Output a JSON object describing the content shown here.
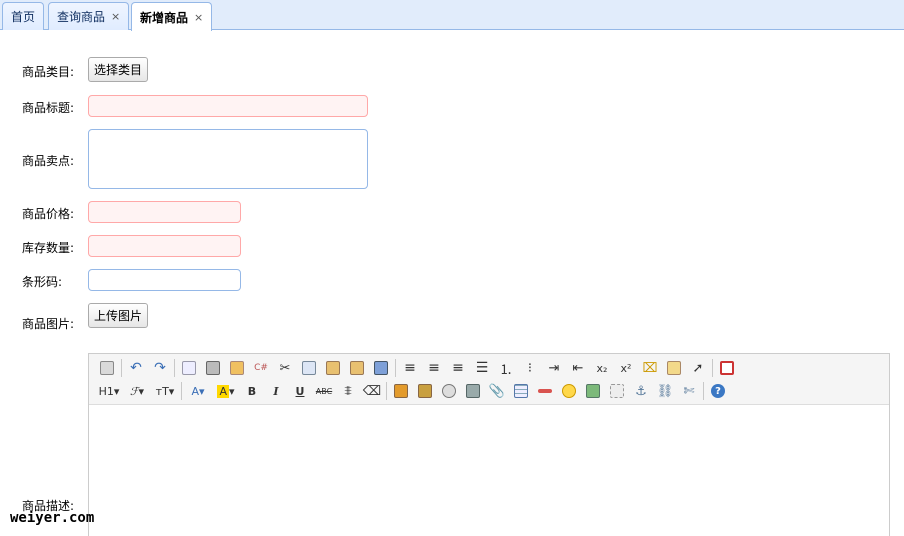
{
  "tabs": [
    {
      "label": "首页",
      "closable": false,
      "active": false
    },
    {
      "label": "查询商品",
      "closable": true,
      "active": false
    },
    {
      "label": "新增商品",
      "closable": true,
      "active": true
    }
  ],
  "close_glyph": "×",
  "form": {
    "category_label": "商品类目:",
    "category_button": "选择类目",
    "title_label": "商品标题:",
    "title_value": "",
    "sellpoint_label": "商品卖点:",
    "sellpoint_value": "",
    "price_label": "商品价格:",
    "price_value": "",
    "stock_label": "库存数量:",
    "stock_value": "",
    "barcode_label": "条形码:",
    "barcode_value": "",
    "image_label": "商品图片:",
    "image_button": "上传图片",
    "desc_label": "商品描述:"
  },
  "editor": {
    "row1": [
      "source-icon",
      "undo-icon",
      "redo-icon",
      "preview-icon",
      "print-icon",
      "template-icon",
      "code-icon",
      "cut-icon",
      "copy-icon",
      "paste-icon",
      "paste-plain-icon",
      "paste-word-icon",
      "align-left-icon",
      "align-center-icon",
      "align-right-icon",
      "align-justify-icon",
      "ordered-list-icon",
      "unordered-list-icon",
      "indent-icon",
      "outdent-icon",
      "subscript-icon",
      "superscript-icon",
      "clear-html-icon",
      "quick-format-icon",
      "select-all-icon",
      "fullscreen-icon"
    ],
    "row2": [
      "heading-icon",
      "font-family-icon",
      "font-size-icon",
      "font-color-icon",
      "highlight-icon",
      "bold-icon",
      "italic-icon",
      "underline-icon",
      "strikethrough-icon",
      "line-height-icon",
      "remove-format-icon",
      "image-icon",
      "multi-image-icon",
      "flash-icon",
      "media-icon",
      "file-icon",
      "table-icon",
      "hr-icon",
      "emoticons-icon",
      "baidu-map-icon",
      "page-break-icon",
      "anchor-icon",
      "link-icon",
      "unlink-icon",
      "about-icon"
    ],
    "text": {
      "heading": "H1",
      "subscript": "x₂",
      "superscript": "x²",
      "font_color": "A",
      "highlight": "A",
      "bold": "B",
      "italic": "I",
      "underline": "U",
      "strike": "ABC",
      "about": "?"
    }
  },
  "watermark": "weiyer.com",
  "colors": {
    "tab_bar": "#e1ecfb",
    "tab_border": "#95b8e7",
    "invalid_border": "#ffa8a8",
    "invalid_bg": "#fff3f3"
  }
}
